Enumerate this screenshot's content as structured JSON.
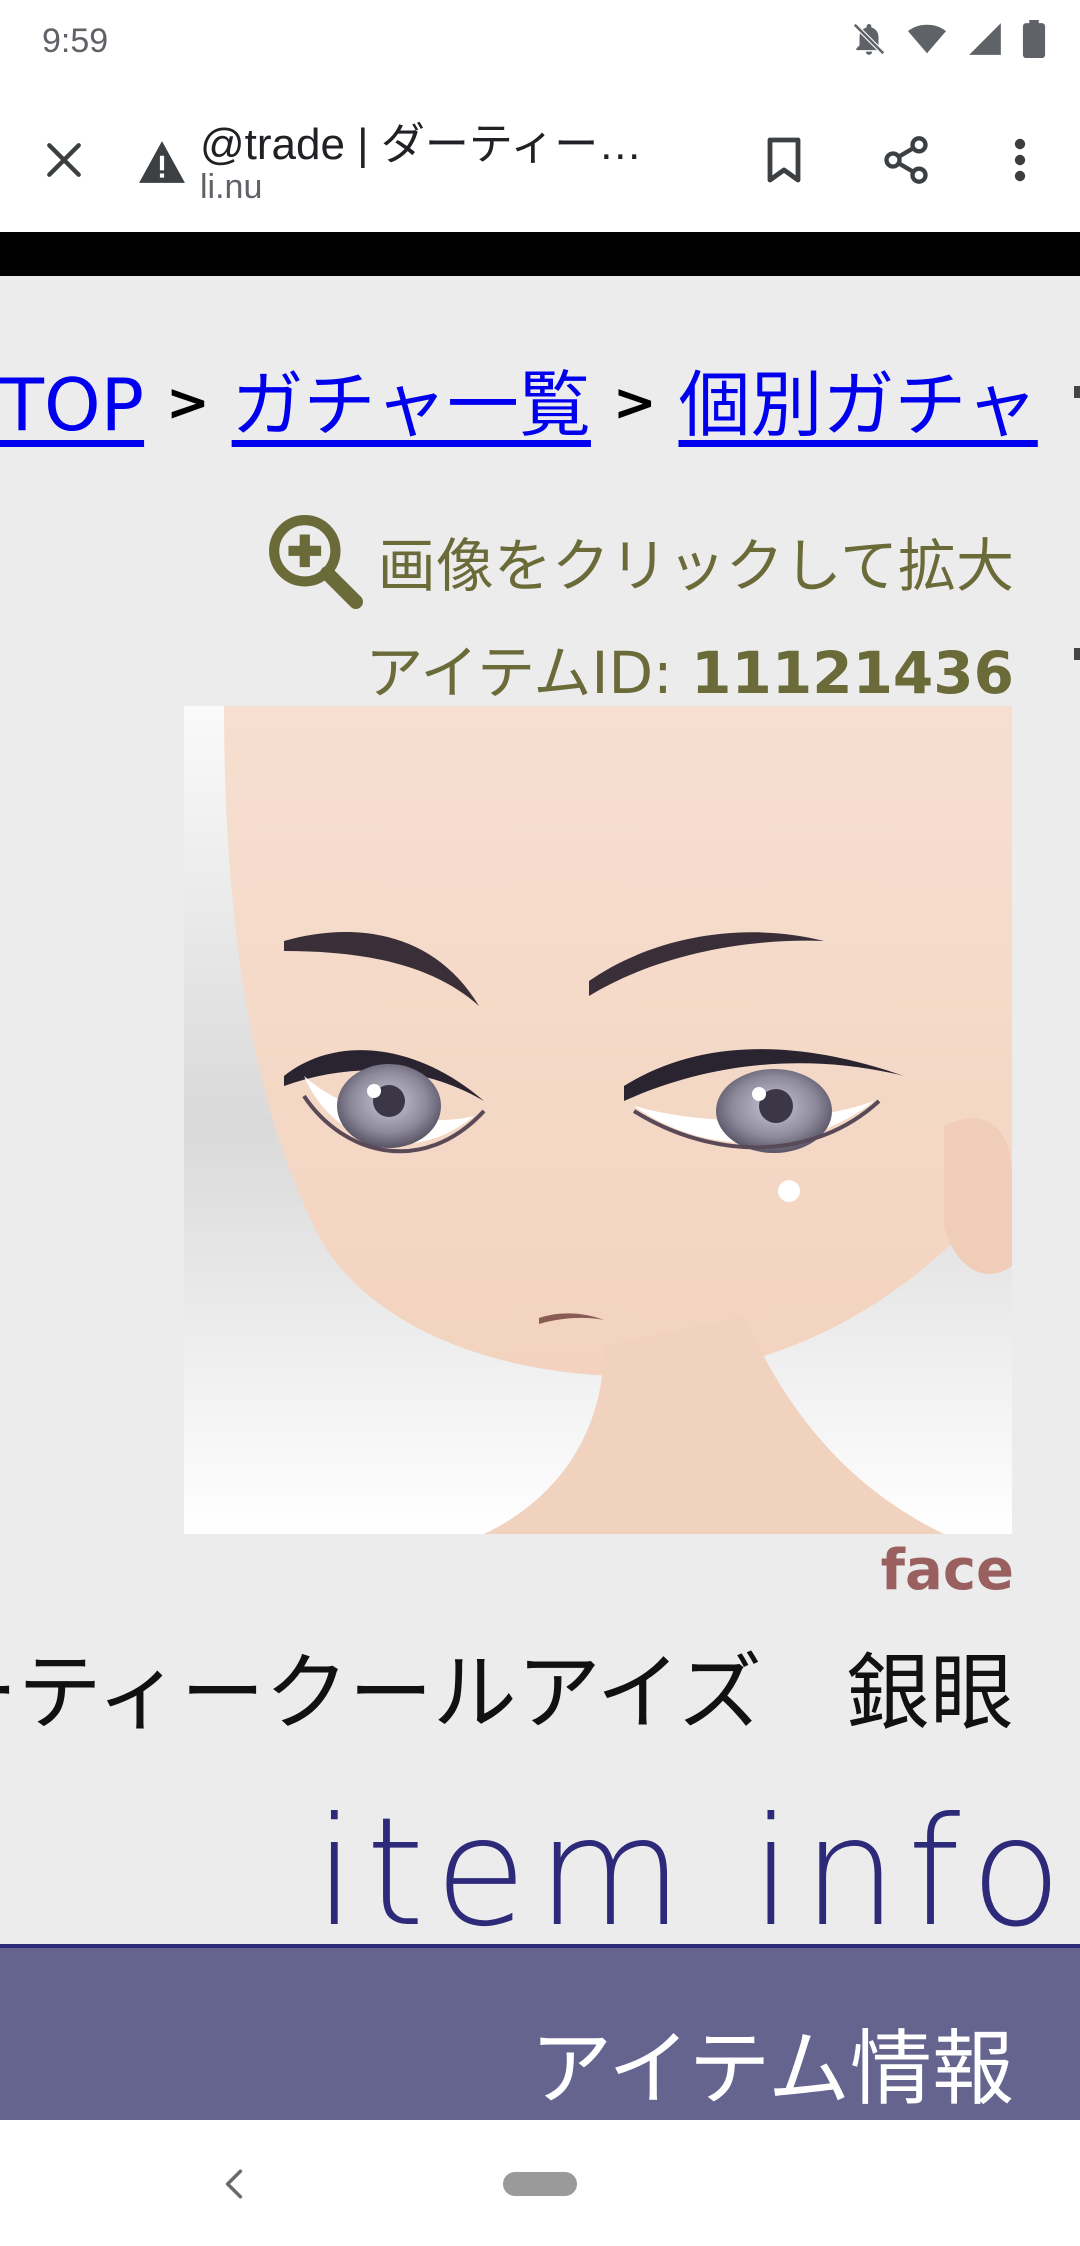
{
  "status_bar": {
    "time": "9:59",
    "icons": [
      "notifications-off-icon",
      "wifi-icon",
      "signal-icon",
      "battery-icon"
    ]
  },
  "browser": {
    "page_title": "@trade | ダーティー…",
    "domain": "li.nu",
    "icons": [
      "close-icon",
      "warning-icon",
      "bookmark-icon",
      "share-icon",
      "more-vert-icon"
    ]
  },
  "breadcrumb": {
    "items": [
      "TOP",
      "ガチャ一覧",
      "個別ガチャ"
    ],
    "separator": ">"
  },
  "zoom_hint": {
    "icon": "zoom-in-icon",
    "text": "画像をクリックして拡大"
  },
  "item": {
    "id_label": "アイテムID:",
    "id_value": "11121436",
    "category": "face",
    "name": "ーティークールアイズ　銀眼"
  },
  "section": {
    "heading": "item info",
    "label": "アイテム情報"
  },
  "colors": {
    "link": "#0000ee",
    "olive_text": "#6b6b3a",
    "category": "#9a6060",
    "heading": "#2e2a7a",
    "band": "#64648f"
  }
}
